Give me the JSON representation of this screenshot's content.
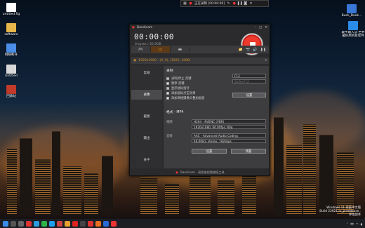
{
  "desktop": {
    "icons_left": [
      {
        "label": "untitled.fig",
        "icon": "figma-file-icon",
        "color": "#ffffff"
      },
      {
        "label": "software",
        "icon": "folder-icon",
        "color": "#e8b64a"
      },
      {
        "label": "网络断开",
        "icon": "network-folder-icon",
        "color": "#4a8ee8"
      },
      {
        "label": "Untitled",
        "icon": "document-icon",
        "color": "#d8d8d8"
      },
      {
        "label": "回收站",
        "icon": "recycle-bin-icon",
        "color": "#c23a2a"
      }
    ],
    "icons_right": [
      {
        "label": "Buck_Book...",
        "icon": "document-icon",
        "color": "#3a78d8"
      },
      {
        "label": "最牛输入法·世界最好用的新软件",
        "icon": "app-icon",
        "color": "#2a8ce8"
      }
    ],
    "watermark_lines": [
      "Windows 11 家庭中文版",
      "Build 22621 rs_prerelease..",
      "评估副本"
    ]
  },
  "overlay_bar": {
    "title": "正在录制 [00:00:00]"
  },
  "bandicam": {
    "title": "Bandicam",
    "timer": "00:00:00",
    "size": "0 bytes / 20.9GB",
    "tabs": [
      {
        "label": "🎮",
        "icon": "game-controller-icon"
      },
      {
        "label": "▭",
        "icon": "screen-rect-icon",
        "selected": true
      },
      {
        "label": "▬",
        "icon": "hdmi-icon"
      }
    ],
    "toolbar_right": [
      "📁",
      "📷",
      "🔊",
      "❚❚"
    ],
    "source": "1920x1080 - (0, 0), (1920, 1080)",
    "sidebar": [
      {
        "label": "常规"
      },
      {
        "label": "录像",
        "selected": true
      },
      {
        "label": "截图"
      },
      {
        "label": "输出"
      },
      {
        "label": "关于"
      }
    ],
    "record_section": "录制",
    "options": [
      {
        "label": "录制/停止 热键",
        "checked": true,
        "hotkey": "F12"
      },
      {
        "label": "暂停 热键",
        "checked": false,
        "hotkey": "Shift+F12"
      },
      {
        "label": "显示鼠标指针",
        "checked": true
      },
      {
        "label": "添加鼠标点击效果",
        "checked": false
      },
      {
        "label": "添加网络摄像头叠加画面",
        "checked": false
      }
    ],
    "settings_btn": "设置",
    "format_section": "格式 - MP4",
    "video_label": "视频",
    "video_codec": "H264 - NVENC (VBR)",
    "video_detail": "1920x1080, 60.00fps, 80q",
    "audio_label": "音频",
    "audio_codec": "AAC - Advanced Audio Coding",
    "audio_detail": "48.0KHz, stereo, 192kbps",
    "settings_btn2": "设置",
    "presets_btn": "预置",
    "footer": "Bandicam - 高性能视频捕捉工具"
  },
  "taskbar": {
    "time": "",
    "tray_text": "中"
  }
}
